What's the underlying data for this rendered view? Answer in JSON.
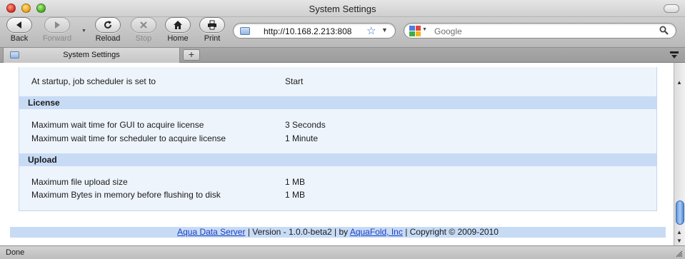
{
  "window": {
    "title": "System Settings"
  },
  "toolbar": {
    "back_label": "Back",
    "forward_label": "Forward",
    "reload_label": "Reload",
    "stop_label": "Stop",
    "home_label": "Home",
    "print_label": "Print"
  },
  "address_bar": {
    "url": "http://10.168.2.213:808"
  },
  "search": {
    "placeholder": "Google"
  },
  "tabs": [
    {
      "label": "System Settings"
    }
  ],
  "content": {
    "startup_row": {
      "key": "At startup, job scheduler is set to",
      "value": "Start"
    },
    "sections": [
      {
        "title": "License",
        "rows": [
          {
            "key": "Maximum wait time for GUI to acquire license",
            "value": "3 Seconds"
          },
          {
            "key": "Maximum wait time for scheduler to acquire license",
            "value": "1 Minute"
          }
        ]
      },
      {
        "title": "Upload",
        "rows": [
          {
            "key": "Maximum file upload size",
            "value": "1 MB"
          },
          {
            "key": "Maximum Bytes in memory before flushing to disk",
            "value": "1 MB"
          }
        ]
      }
    ]
  },
  "footer": {
    "product_link": "Aqua Data Server",
    "version_text": " | Version - 1.0.0-beta2 | by ",
    "company_link": "AquaFold, Inc",
    "copyright_text": " | Copyright © 2009-2010"
  },
  "status": {
    "text": "Done"
  },
  "colors": {
    "section_header_bg": "#c7dbf5",
    "panel_bg": "#eef4fc",
    "link": "#1b3fc4",
    "scroll_thumb": "#5b93db"
  },
  "icons": [
    "back-arrow-icon",
    "forward-arrow-icon",
    "reload-icon",
    "stop-x-icon",
    "home-icon",
    "printer-icon",
    "folder-favicon-icon",
    "bookmark-star-icon",
    "google-logo-icon",
    "magnifier-icon",
    "plus-icon",
    "tab-list-icon",
    "resize-grip-icon"
  ]
}
